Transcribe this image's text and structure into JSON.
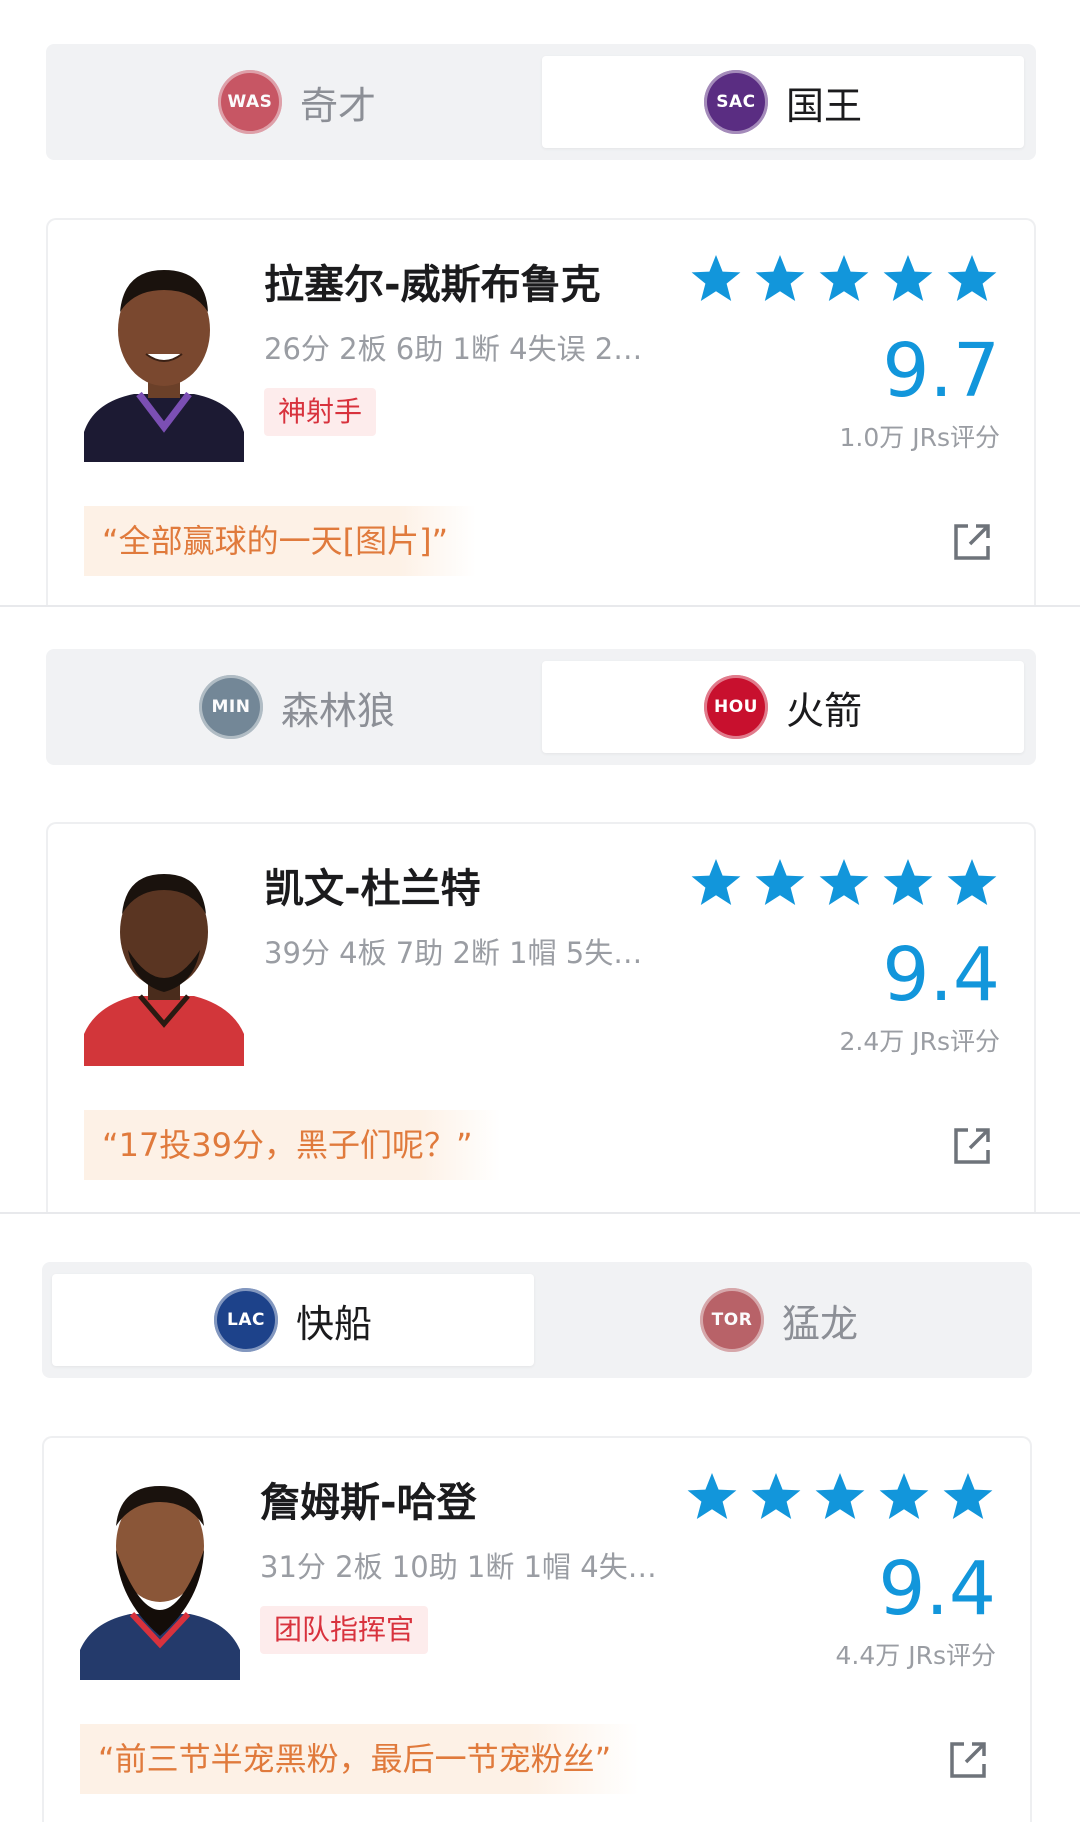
{
  "games": [
    {
      "teams": [
        {
          "name": "奇才",
          "logo_text": "WAS",
          "color": "#b92235"
        },
        {
          "name": "国王",
          "logo_text": "SAC",
          "color": "#5a2d82"
        }
      ],
      "active_tab": 1,
      "player": {
        "name": "拉塞尔-威斯布鲁克",
        "stats": "26分 2板 6助 1断 4失误 2…",
        "badge": "神射手",
        "stars": 5,
        "score": "9.7",
        "ratings": "1.0万 JRs评分",
        "quote": "“全部赢球的一天[图片]”",
        "jersey_color": "#1c1a33"
      }
    },
    {
      "teams": [
        {
          "name": "森林狼",
          "logo_text": "MIN",
          "color": "#4a6478"
        },
        {
          "name": "火箭",
          "logo_text": "HOU",
          "color": "#c8102e"
        }
      ],
      "active_tab": 1,
      "player": {
        "name": "凯文-杜兰特",
        "stats": "39分 4板 7助 2断 1帽 5失…",
        "badge": "",
        "stars": 5,
        "score": "9.4",
        "ratings": "2.4万 JRs评分",
        "quote": "“17投39分，黑子们呢？”",
        "jersey_color": "#d2363a"
      }
    },
    {
      "teams": [
        {
          "name": "快船",
          "logo_text": "LAC",
          "color": "#1d428a"
        },
        {
          "name": "猛龙",
          "logo_text": "TOR",
          "color": "#a5323a"
        }
      ],
      "active_tab": 0,
      "player": {
        "name": "詹姆斯-哈登",
        "stats": "31分 2板 10助 1断 1帽 4失…",
        "badge": "团队指挥官",
        "stars": 5,
        "score": "9.4",
        "ratings": "4.4万 JRs评分",
        "quote": "“前三节半宠黑粉，最后一节宠粉丝”",
        "jersey_color": "#243a6b"
      }
    }
  ],
  "colors": {
    "accent_blue": "#1296db",
    "badge_red": "#d8323d",
    "quote_orange": "#e07a3c"
  }
}
